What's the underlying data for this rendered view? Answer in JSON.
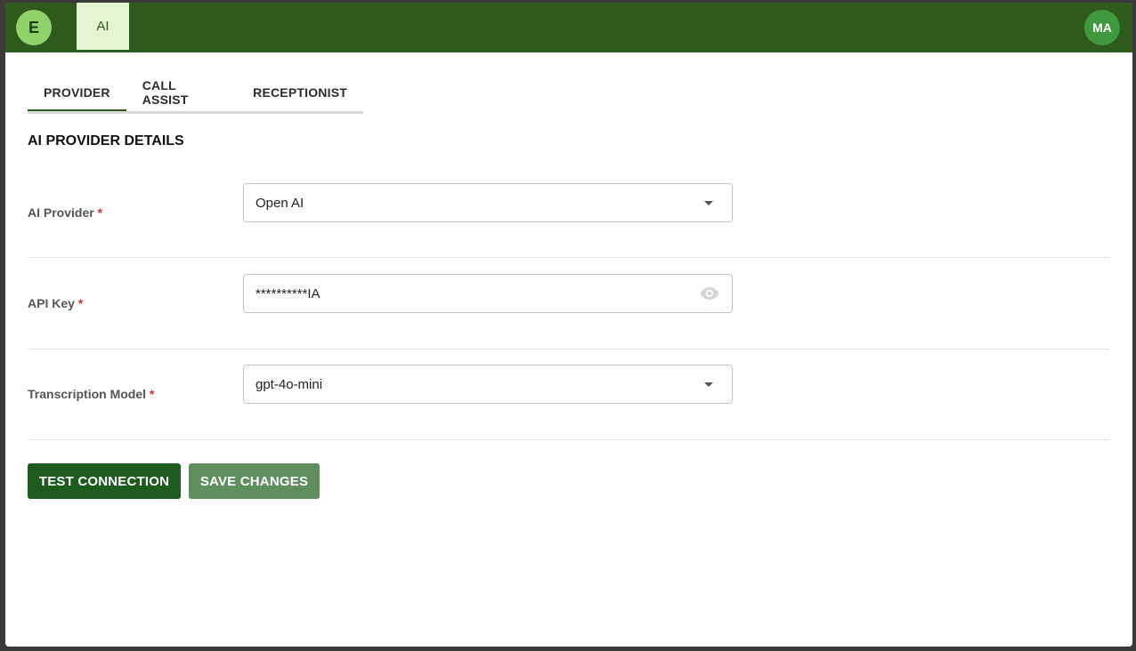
{
  "header": {
    "logo_letter": "E",
    "nav_item": "AI",
    "user_initials": "MA",
    "brand_color": "#2e5a1c"
  },
  "tabs": [
    {
      "label": "PROVIDER",
      "active": true
    },
    {
      "label": "CALL ASSIST",
      "active": false
    },
    {
      "label": "RECEPTIONIST",
      "active": false
    }
  ],
  "section_title": "AI PROVIDER DETAILS",
  "form": {
    "provider": {
      "label": "AI Provider",
      "required_mark": "*",
      "value": "Open AI"
    },
    "api_key": {
      "label": "API Key",
      "required_mark": "*",
      "value": "**********IA"
    },
    "model": {
      "label": "Transcription Model",
      "required_mark": "*",
      "value": "gpt-4o-mini"
    }
  },
  "buttons": {
    "test": "TEST CONNECTION",
    "save": "SAVE CHANGES"
  },
  "icons": {
    "dropdown": "chevron-down-icon",
    "visibility": "eye-icon"
  }
}
